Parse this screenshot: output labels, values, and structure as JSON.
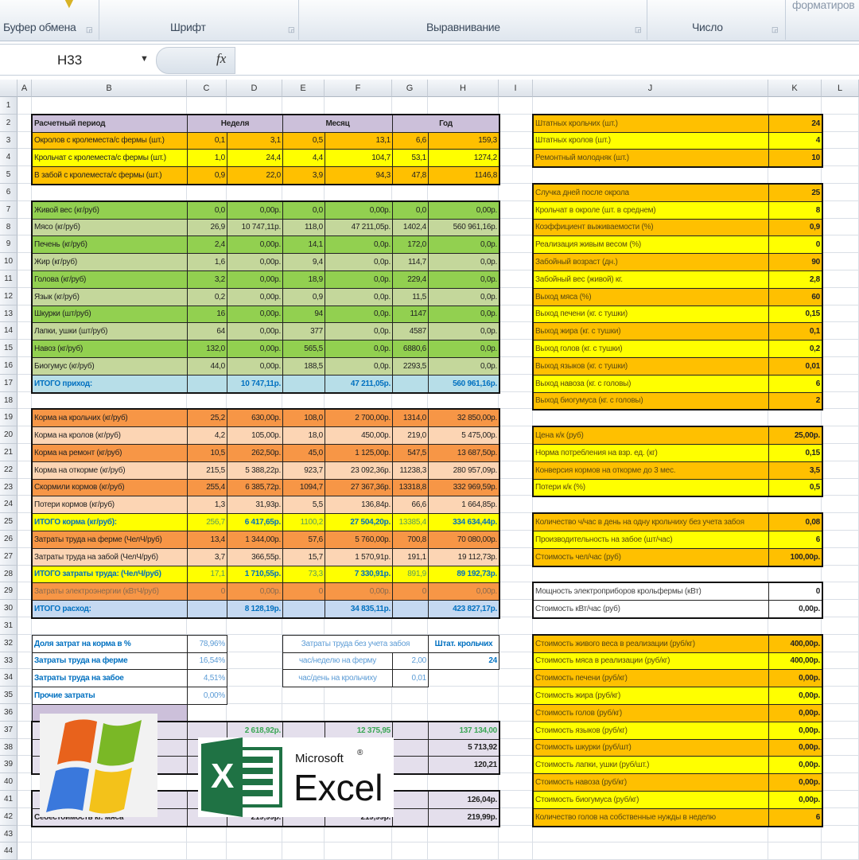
{
  "ribbon": {
    "groups": [
      "Буфер обмена",
      "Шрифт",
      "Выравнивание",
      "Число",
      "форматиров"
    ]
  },
  "formula_bar": {
    "name_box": "H33",
    "fx_label": "fx",
    "formula": ""
  },
  "columns": [
    "A",
    "B",
    "C",
    "D",
    "E",
    "F",
    "G",
    "H",
    "I",
    "J",
    "K",
    "L"
  ],
  "row_count": 44,
  "colors": {
    "orange": "#ffc000",
    "yellow": "#ffff00",
    "green": "#92d050",
    "light_green": "#c4d79b",
    "lavender": "#ccc0da",
    "light_lavender": "#e4dfec",
    "blue_band": "#b7dee8",
    "steel": "#c5d9f1",
    "deep_orange": "#f79646",
    "peach": "#fcd5b4",
    "blue_text": "#0070c0",
    "green_text": "#3aa655"
  },
  "left_table": [
    {
      "row": 2,
      "fill": "#ccc0da",
      "bold": true,
      "label": "Расчетный период",
      "merged": [
        "Неделя",
        "Месяц",
        "Год"
      ]
    },
    {
      "row": 3,
      "fill": "#ffc000",
      "label": "Окролов с кролеместа/с фермы (шт.)",
      "vals": [
        "0,1",
        "3,1",
        "0,5",
        "13,1",
        "6,6",
        "159,3"
      ]
    },
    {
      "row": 4,
      "fill": "#ffff00",
      "label": "Крольчат с кролеместа/с фермы (шт.)",
      "vals": [
        "1,0",
        "24,4",
        "4,4",
        "104,7",
        "53,1",
        "1274,2"
      ]
    },
    {
      "row": 5,
      "fill": "#ffc000",
      "label": "В забой с кролеместа/с фермы (шт.)",
      "vals": [
        "0,9",
        "22,0",
        "3,9",
        "94,3",
        "47,8",
        "1146,8"
      ]
    },
    {
      "row": 7,
      "fill": "#92d050",
      "label": "Живой вес (кг/руб)",
      "vals": [
        "0,0",
        "0,00р.",
        "0,0",
        "0,00р.",
        "0,0",
        "0,00р."
      ]
    },
    {
      "row": 8,
      "fill": "#c4d79b",
      "label": "Мясо (кг/руб)",
      "vals": [
        "26,9",
        "10 747,11р.",
        "118,0",
        "47 211,05р.",
        "1402,4",
        "560 961,16р."
      ]
    },
    {
      "row": 9,
      "fill": "#92d050",
      "label": "Печень (кг/руб)",
      "vals": [
        "2,4",
        "0,00р.",
        "14,1",
        "0,0р.",
        "172,0",
        "0,0р."
      ]
    },
    {
      "row": 10,
      "fill": "#c4d79b",
      "label": "Жир (кг/руб)",
      "vals": [
        "1,6",
        "0,00р.",
        "9,4",
        "0,0р.",
        "114,7",
        "0,0р."
      ]
    },
    {
      "row": 11,
      "fill": "#92d050",
      "label": "Голова (кг/руб)",
      "vals": [
        "3,2",
        "0,00р.",
        "18,9",
        "0,0р.",
        "229,4",
        "0,0р."
      ]
    },
    {
      "row": 12,
      "fill": "#c4d79b",
      "label": "Язык (кг/руб)",
      "vals": [
        "0,2",
        "0,00р.",
        "0,9",
        "0,0р.",
        "11,5",
        "0,0р."
      ]
    },
    {
      "row": 13,
      "fill": "#92d050",
      "label": "Шкурки (шт/руб)",
      "vals": [
        "16",
        "0,00р.",
        "94",
        "0,0р.",
        "1147",
        "0,0р."
      ]
    },
    {
      "row": 14,
      "fill": "#c4d79b",
      "label": "Лапки, ушки (шт/руб)",
      "vals": [
        "64",
        "0,00р.",
        "377",
        "0,0р.",
        "4587",
        "0,0р."
      ]
    },
    {
      "row": 15,
      "fill": "#92d050",
      "label": "Навоз (кг/руб)",
      "vals": [
        "132,0",
        "0,00р.",
        "565,5",
        "0,0р.",
        "6880,6",
        "0,0р."
      ]
    },
    {
      "row": 16,
      "fill": "#c4d79b",
      "label": "Биогумус (кг/руб)",
      "vals": [
        "44,0",
        "0,00р.",
        "188,5",
        "0,0р.",
        "2293,5",
        "0,0р."
      ]
    },
    {
      "row": 17,
      "fill": "#b7dee8",
      "bold": true,
      "color": "#0070c0",
      "label": "ИТОГО приход:",
      "vals": [
        "",
        "10 747,11р.",
        "",
        "47 211,05р.",
        "",
        "560 961,16р."
      ]
    },
    {
      "row": 19,
      "fill": "#f79646",
      "label": "Корма на крольчих (кг/руб)",
      "vals": [
        "25,2",
        "630,00р.",
        "108,0",
        "2 700,00р.",
        "1314,0",
        "32 850,00р."
      ]
    },
    {
      "row": 20,
      "fill": "#fcd5b4",
      "label": "Корма на кролов (кг/руб)",
      "vals": [
        "4,2",
        "105,00р.",
        "18,0",
        "450,00р.",
        "219,0",
        "5 475,00р."
      ]
    },
    {
      "row": 21,
      "fill": "#f79646",
      "label": "Корма на ремонт (кг/руб)",
      "vals": [
        "10,5",
        "262,50р.",
        "45,0",
        "1 125,00р.",
        "547,5",
        "13 687,50р."
      ]
    },
    {
      "row": 22,
      "fill": "#fcd5b4",
      "label": "Корма на откорме (кг/руб)",
      "vals": [
        "215,5",
        "5 388,22р.",
        "923,7",
        "23 092,36р.",
        "11238,3",
        "280 957,09р."
      ]
    },
    {
      "row": 23,
      "fill": "#f79646",
      "label": "Скормили кормов (кг/руб)",
      "vals": [
        "255,4",
        "6 385,72р.",
        "1094,7",
        "27 367,36р.",
        "13318,8",
        "332 969,59р."
      ]
    },
    {
      "row": 24,
      "fill": "#fcd5b4",
      "label": "Потери кормов (кг/руб)",
      "vals": [
        "1,3",
        "31,93р.",
        "5,5",
        "136,84р.",
        "66,6",
        "1 664,85р."
      ]
    },
    {
      "row": 25,
      "fill": "#ffff00",
      "bold": true,
      "color": "#0070c0",
      "qty_color": "#5a9e5a",
      "label": "ИТОГО корма (кг/руб):",
      "vals": [
        "256,7",
        "6 417,65р.",
        "1100,2",
        "27 504,20р.",
        "13385,4",
        "334 634,44р."
      ]
    },
    {
      "row": 26,
      "fill": "#f79646",
      "label": "Затраты труда на ферме (ЧелЧ/руб)",
      "vals": [
        "13,4",
        "1 344,00р.",
        "57,6",
        "5 760,00р.",
        "700,8",
        "70 080,00р."
      ]
    },
    {
      "row": 27,
      "fill": "#fcd5b4",
      "label": "Затраты труда на забой (ЧелЧ/руб)",
      "vals": [
        "3,7",
        "366,55р.",
        "15,7",
        "1 570,91р.",
        "191,1",
        "19 112,73р."
      ]
    },
    {
      "row": 28,
      "fill": "#ffff00",
      "bold": true,
      "color": "#0070c0",
      "qty_color": "#5a9e5a",
      "label": "ИТОГО затраты труда: (ЧелЧ/руб)",
      "vals": [
        "17,1",
        "1 710,55р.",
        "73,3",
        "7 330,91р.",
        "891,9",
        "89 192,73р."
      ]
    },
    {
      "row": 29,
      "fill": "#f79646",
      "color": "#8a6a50",
      "label": "Затраты электроэнергии (кВтЧ/руб)",
      "vals": [
        "0",
        "0,00р.",
        "0",
        "0,00р.",
        "0",
        "0,00р."
      ]
    },
    {
      "row": 30,
      "fill": "#c5d9f1",
      "bold": true,
      "color": "#0070c0",
      "label": "ИТОГО расход:",
      "vals": [
        "",
        "8 128,19р.",
        "",
        "34 835,11р.",
        "",
        "423 827,17р."
      ]
    },
    {
      "row": 37,
      "fill": "#e4dfec",
      "bold": true,
      "color": "#3aa655",
      "label": "",
      "vals": [
        "",
        "2 618,92р.",
        "",
        "12 375,95",
        "",
        "137 134,00"
      ]
    },
    {
      "row": 38,
      "fill": "#e4dfec",
      "bold": true,
      "label": "",
      "vals": [
        "",
        "",
        "",
        "",
        "",
        "5 713,92"
      ]
    },
    {
      "row": 39,
      "fill": "#e4dfec",
      "bold": true,
      "label": "",
      "vals": [
        "",
        "",
        "",
        "",
        "",
        "120,21"
      ]
    },
    {
      "row": 41,
      "fill": "#e4dfec",
      "bold": true,
      "label": "",
      "vals": [
        "",
        "",
        "",
        "",
        "",
        "126,04р."
      ]
    },
    {
      "row": 42,
      "fill": "#e4dfec",
      "bold": true,
      "label": "Себестоимость кг. мяса",
      "vals": [
        "",
        "219,99р.",
        "",
        "219,99р.",
        "",
        "219,99р."
      ]
    }
  ],
  "shares": [
    {
      "row": 32,
      "label": "Доля затрат на корма в %",
      "value": "78,96%"
    },
    {
      "row": 33,
      "label": "Затраты труда на ферме",
      "value": "16,54%"
    },
    {
      "row": 34,
      "label": "Затраты труда на забое",
      "value": "4,51%"
    },
    {
      "row": 35,
      "label": "Прочие затраты",
      "value": "0,00%"
    }
  ],
  "labor_box": {
    "title": "Затраты труда без учета забоя",
    "staff_header": "Штат. крольчих",
    "staff_value": "24",
    "rows": [
      {
        "row": 33,
        "label": "час/неделю на ферму",
        "value": "2,00"
      },
      {
        "row": 34,
        "label": "час/день на крольчиху",
        "value": "0,01"
      }
    ]
  },
  "params": [
    {
      "row": 2,
      "label": "Штатных крольчих (шт.)",
      "value": "24"
    },
    {
      "row": 3,
      "label": "Штатных кролов (шт.)",
      "value": "4"
    },
    {
      "row": 4,
      "label": "Ремонтный молодняк (шт.)",
      "value": "10"
    },
    {
      "row": 6,
      "label": "Случка дней после окрола",
      "value": "25"
    },
    {
      "row": 7,
      "label": "Крольчат в окроле (шт. в среднем)",
      "value": "8"
    },
    {
      "row": 8,
      "label": "Коэффициент выживаемости (%)",
      "value": "0,9"
    },
    {
      "row": 9,
      "label": "Реализация живым весом (%)",
      "value": "0"
    },
    {
      "row": 10,
      "label": "Забойный возраст (дн.)",
      "value": "90"
    },
    {
      "row": 11,
      "label": "Забойный вес (живой) кг.",
      "value": "2,8"
    },
    {
      "row": 12,
      "label": "Выход мяса (%)",
      "value": "60"
    },
    {
      "row": 13,
      "label": "Выход печени (кг. с тушки)",
      "value": "0,15"
    },
    {
      "row": 14,
      "label": "Выход жира (кг. с тушки)",
      "value": "0,1"
    },
    {
      "row": 15,
      "label": "Выход голов (кг. с тушки)",
      "value": "0,2"
    },
    {
      "row": 16,
      "label": "Выход языков (кг. с тушки)",
      "value": "0,01"
    },
    {
      "row": 17,
      "label": "Выход навоза (кг. с головы)",
      "value": "6"
    },
    {
      "row": 18,
      "label": "Выход биогумуса (кг. с головы)",
      "value": "2"
    },
    {
      "row": 20,
      "label": "Цена к/к (руб)",
      "value": "25,00р."
    },
    {
      "row": 21,
      "label": "Норма потребления на взр. ед. (кг)",
      "value": "0,15"
    },
    {
      "row": 22,
      "label": "Конверсия кормов на откорме  до 3 мес.",
      "value": "3,5"
    },
    {
      "row": 23,
      "label": "Потери к/к (%)",
      "value": "0,5"
    },
    {
      "row": 25,
      "label": "Количество ч/час в день на одну крольчиху без учета забоя",
      "value": "0,08"
    },
    {
      "row": 26,
      "label": "Производительность на забое (шт/час)",
      "value": "6"
    },
    {
      "row": 27,
      "label": "Стоимость чел/час (руб)",
      "value": "100,00р."
    },
    {
      "row": 29,
      "label": "Мощность электроприборов крольфермы (кВт)",
      "value": "0",
      "white": true
    },
    {
      "row": 30,
      "label": "Стоимость кВт/час (руб)",
      "value": "0,00р.",
      "white": true
    },
    {
      "row": 32,
      "label": "Стоимость живого веса в реализации (руб/кг)",
      "value": "400,00р."
    },
    {
      "row": 33,
      "label": "Стоимость мяса в реализации (руб/кг)",
      "value": "400,00р."
    },
    {
      "row": 34,
      "label": "Стоимость печени (руб/кг)",
      "value": "0,00р."
    },
    {
      "row": 35,
      "label": "Стоимость жира (руб/кг)",
      "value": "0,00р."
    },
    {
      "row": 36,
      "label": "Стоимость голов (руб/кг)",
      "value": "0,00р."
    },
    {
      "row": 37,
      "label": "Стоимость языков (руб/кг)",
      "value": "0,00р."
    },
    {
      "row": 38,
      "label": "Стоимость шкурки (руб/шт)",
      "value": "0,00р."
    },
    {
      "row": 39,
      "label": "Стоимость лапки, ушки (руб/шт.)",
      "value": "0,00р."
    },
    {
      "row": 40,
      "label": "Стоимость навоза (руб/кг)",
      "value": "0,00р."
    },
    {
      "row": 41,
      "label": "Стоимость биогумуса (руб/кг)",
      "value": "0,00р."
    },
    {
      "row": 42,
      "label": "Количество голов на собственные нужды в неделю",
      "value": "6"
    }
  ],
  "logos": {
    "windows": "Windows logo",
    "excel_brand": "Microsoft",
    "excel_registered": "®",
    "excel_name": "Excel",
    "excel_letter": "X"
  }
}
